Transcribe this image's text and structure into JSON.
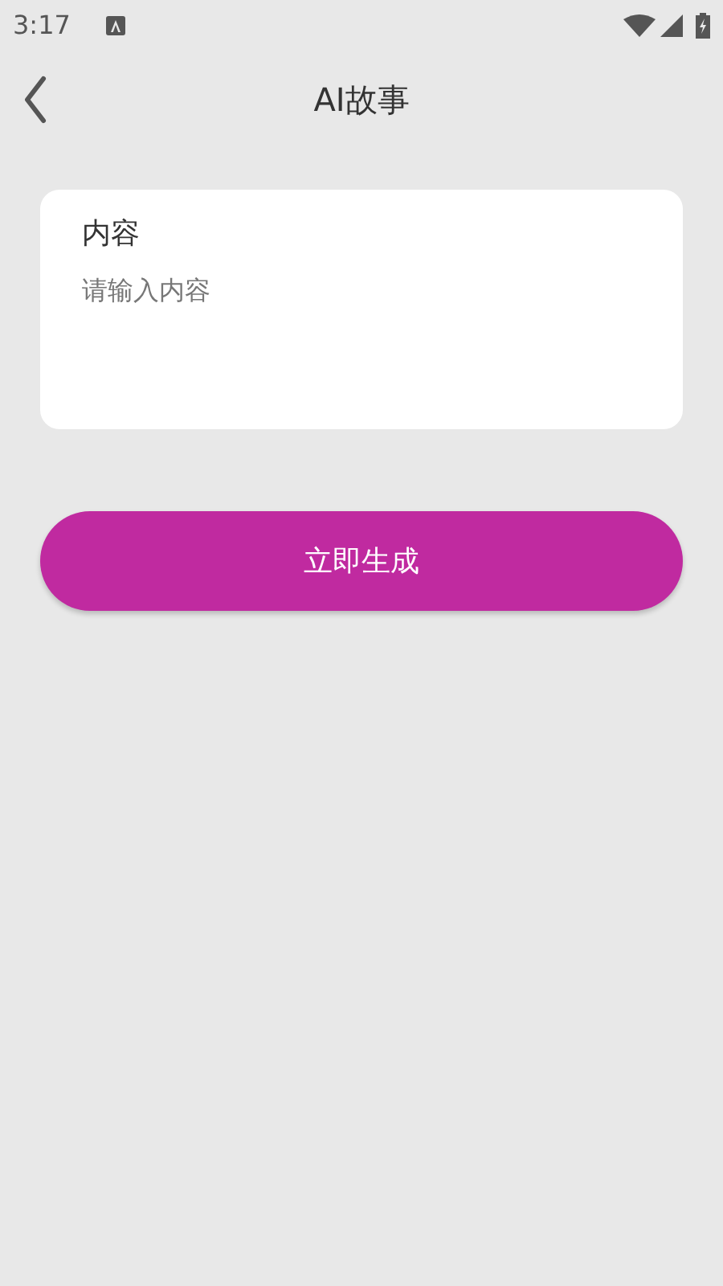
{
  "status_bar": {
    "time": "3:17"
  },
  "header": {
    "title": "AI故事"
  },
  "content_card": {
    "label": "内容",
    "placeholder": "请输入内容"
  },
  "generate_button": {
    "label": "立即生成"
  }
}
